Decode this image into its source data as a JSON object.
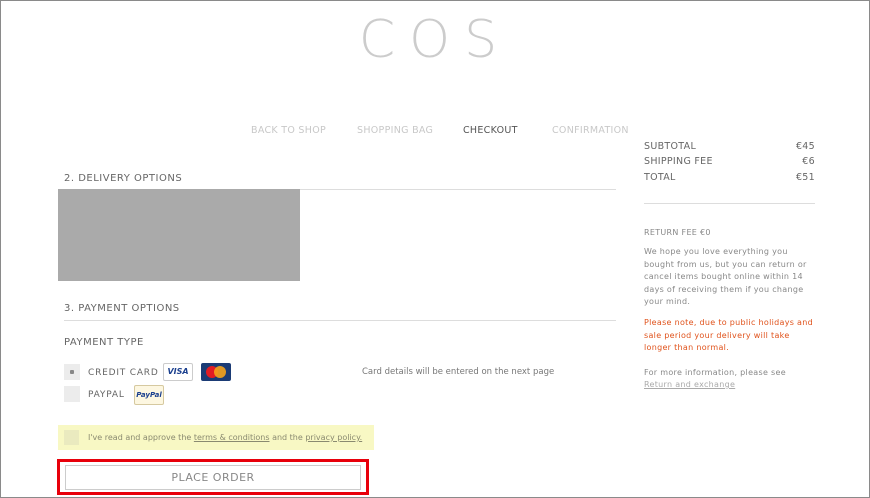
{
  "brand": {
    "logo": "COS"
  },
  "nav": {
    "items": [
      {
        "label": "BACK TO SHOP",
        "active": false
      },
      {
        "label": "SHOPPING BAG",
        "active": false
      },
      {
        "label": "CHECKOUT",
        "active": true
      },
      {
        "label": "CONFIRMATION",
        "active": false
      }
    ]
  },
  "delivery": {
    "heading": "2. DELIVERY OPTIONS"
  },
  "payment": {
    "heading": "3. PAYMENT OPTIONS",
    "type_label": "PAYMENT TYPE",
    "options": [
      {
        "label": "CREDIT CARD",
        "selected": true,
        "icons": [
          "visa-icon",
          "mastercard-icon"
        ]
      },
      {
        "label": "PAYPAL",
        "selected": false,
        "icons": [
          "paypal-icon"
        ]
      }
    ],
    "visa_text": "VISA",
    "paypal_text": "PayPal",
    "card_note": "Card details will be entered on the next page"
  },
  "terms": {
    "prefix": "I've read and approve the",
    "terms_link": "terms & conditions",
    "middle": "and the",
    "privacy_link": "privacy policy."
  },
  "place_order": {
    "label": "PLACE ORDER"
  },
  "summary": {
    "rows": [
      {
        "key": "SUBTOTAL",
        "value": "€45"
      },
      {
        "key": "SHIPPING FEE",
        "value": "€6"
      },
      {
        "key": "TOTAL",
        "value": "€51"
      }
    ]
  },
  "returns": {
    "heading": "RETURN FEE €0",
    "body": "We hope you love everything you bought from us, but you can return or cancel items bought online within 14 days of receiving them if you change your mind.",
    "warning": "Please note, due to public holidays and sale period your delivery will take longer than normal.",
    "info": "For more information, please see",
    "link": "Return and exchange"
  },
  "colors": {
    "warning": "#e0531c",
    "highlight": "#f8f8c4",
    "focus_outline": "#e8000b"
  }
}
